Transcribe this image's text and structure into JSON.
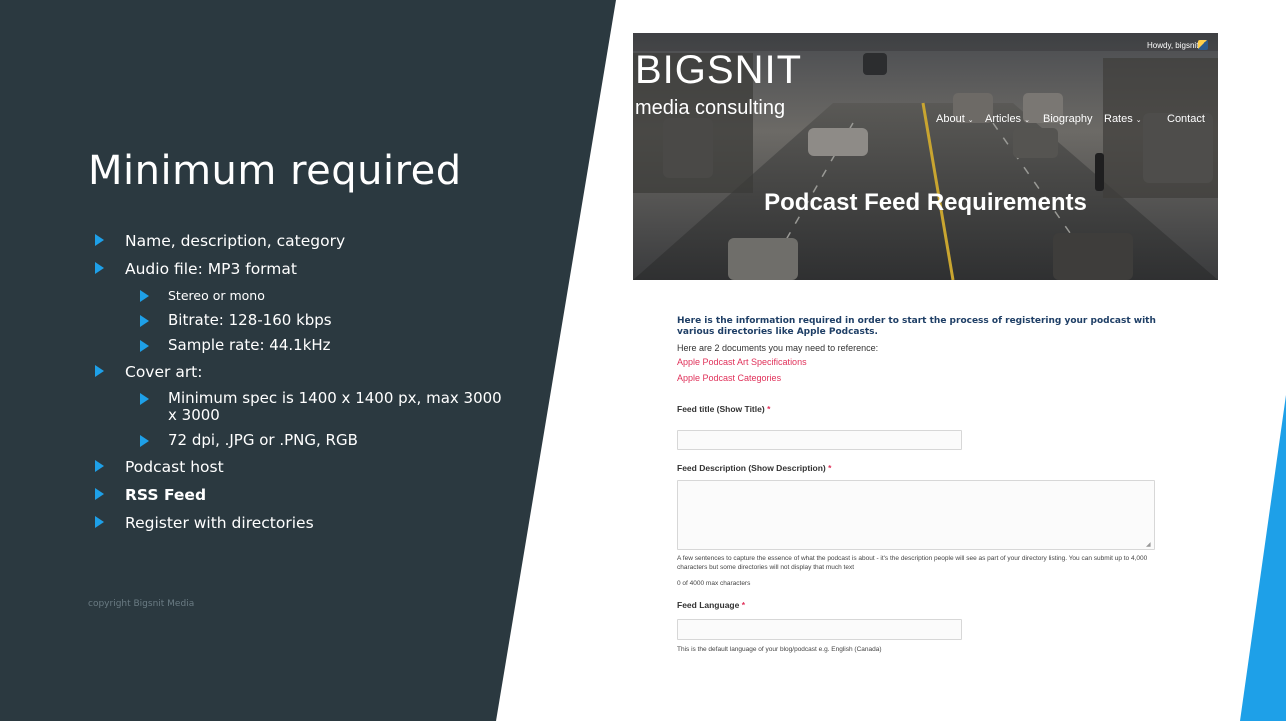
{
  "slide": {
    "title": "Minimum required",
    "colors": {
      "panel": "#2b3940",
      "accent": "#1ea0e8",
      "text": "#ffffff"
    },
    "bullets": [
      {
        "text": "Name, description, category",
        "level": 1
      },
      {
        "text": "Audio file: MP3 format",
        "level": 1
      },
      {
        "text": "Stereo or mono",
        "level": 2
      },
      {
        "text": "Bitrate: 128-160 kbps",
        "level": 2
      },
      {
        "text": "Sample rate: 44.1kHz",
        "level": 2
      },
      {
        "text": "Cover art:",
        "level": 1
      },
      {
        "text": "Minimum spec is 1400 x 1400 px, max 3000 x 3000",
        "level": 2
      },
      {
        "text": "72 dpi,  .JPG or .PNG,  RGB",
        "level": 2
      },
      {
        "text": "Podcast host",
        "level": 1
      },
      {
        "text": "RSS Feed",
        "level": 1,
        "bold": true
      },
      {
        "text": "Register with directories",
        "level": 1
      }
    ],
    "copyright": "copyright Bigsnit Media"
  },
  "screenshot": {
    "admin_bar": {
      "greeting": "Howdy, bigsnit"
    },
    "logo": {
      "main": "BIGSNIT",
      "sub": "media consulting"
    },
    "nav": [
      {
        "label": "About",
        "dropdown": true
      },
      {
        "label": "Articles",
        "dropdown": true
      },
      {
        "label": "Biography",
        "dropdown": false
      },
      {
        "label": "Rates",
        "dropdown": true
      },
      {
        "label": "Contact",
        "dropdown": false
      }
    ],
    "hero_title": "Podcast Feed Requirements",
    "intro": "Here is the information required in order to start the process of registering your podcast with various directories like Apple Podcasts.",
    "refs_text": "Here are 2 documents you may need to reference:",
    "links": [
      "Apple Podcast Art Specifications",
      "Apple Podcast Categories"
    ],
    "form": {
      "feed_title": {
        "label": "Feed title (Show Title)",
        "required": "*",
        "value": ""
      },
      "feed_description": {
        "label": "Feed Description (Show Description)",
        "required": "*",
        "value": "",
        "help": "A few sentences to capture the essence of what the podcast is about - it's the description people will see as part of your directory listing. You can submit up to 4,000 characters but some directories will not display that much text",
        "counter": "0 of 4000 max characters"
      },
      "feed_language": {
        "label": "Feed Language",
        "required": "*",
        "value": "",
        "help": "This is the default language of your blog/podcast e.g. English (Canada)"
      }
    }
  }
}
